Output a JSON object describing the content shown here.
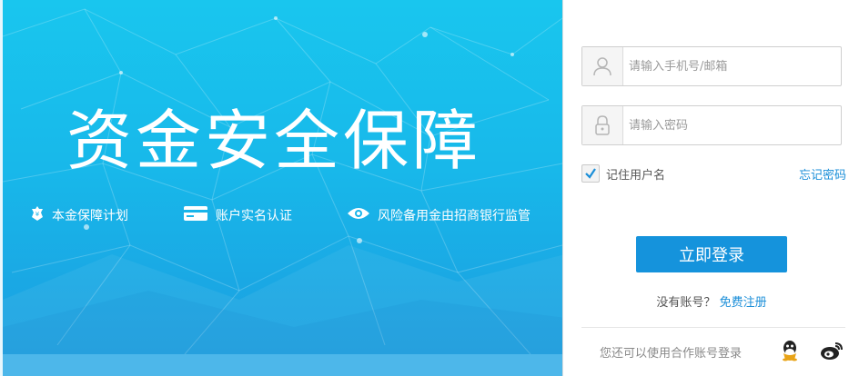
{
  "hero": {
    "title": "资金安全保障",
    "features": [
      {
        "icon": "money-shield-icon",
        "label": "本金保障计划"
      },
      {
        "icon": "id-card-icon",
        "label": "账户实名认证"
      },
      {
        "icon": "eye-icon",
        "label": "风险备用金由招商银行监管"
      }
    ]
  },
  "login": {
    "username_placeholder": "请输入手机号/邮箱",
    "password_placeholder": "请输入密码",
    "remember_label": "记住用户名",
    "remember_checked": true,
    "forgot_label": "忘记密码",
    "submit_label": "立即登录",
    "no_account_text": "没有账号？",
    "register_label": "免费注册",
    "third_party_text": "您还可以使用合作账号登录",
    "third_party_icons": [
      "qq-icon",
      "weibo-icon"
    ]
  },
  "colors": {
    "hero_bg": "#18b8ea",
    "accent": "#1593dc",
    "link": "#1a8ed8"
  }
}
